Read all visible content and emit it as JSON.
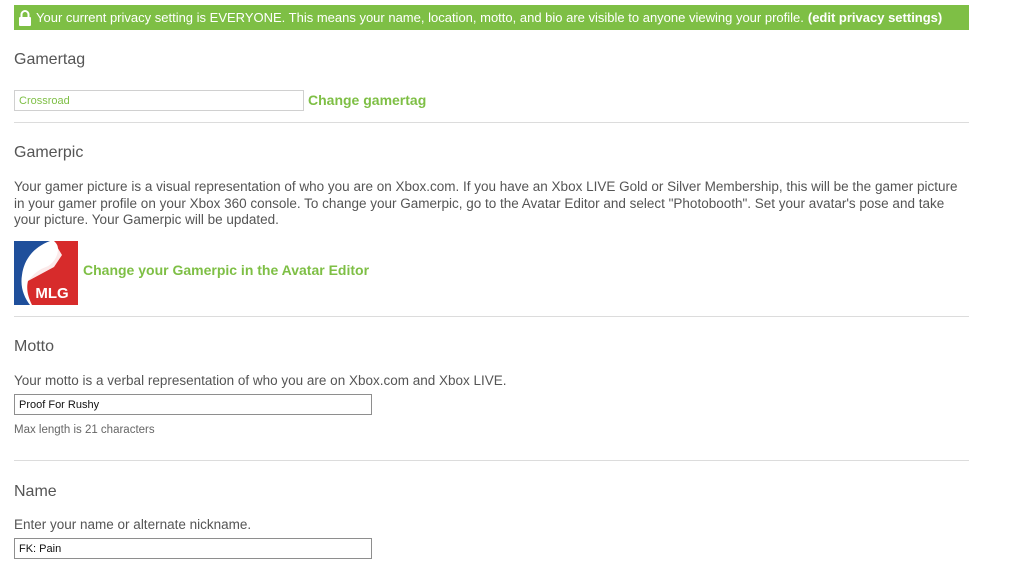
{
  "privacy": {
    "message": "Your current privacy setting is EVERYONE. This means your name, location, motto, and bio are visible to anyone viewing your profile.",
    "link": "(edit privacy settings)",
    "icon": "lock-icon",
    "color": "#7ebf45"
  },
  "gamertag": {
    "title": "Gamertag",
    "value": "Crossroad",
    "change_link": "Change gamertag"
  },
  "gamerpic": {
    "title": "Gamerpic",
    "description": "Your gamer picture is a visual representation of who you are on Xbox.com. If you have an Xbox LIVE Gold or Silver Membership, this will be the gamer picture in your gamer profile on your Xbox 360 console. To change your Gamerpic, go to the Avatar Editor and select \"Photobooth\". Set your avatar's pose and take your picture. Your Gamerpic will be updated.",
    "image_text": "MLG",
    "change_link": "Change your Gamerpic in the Avatar Editor"
  },
  "motto": {
    "title": "Motto",
    "description": "Your motto is a verbal representation of who you are on Xbox.com and Xbox LIVE.",
    "value": "Proof For Rushy",
    "hint": "Max length is 21 characters"
  },
  "name": {
    "title": "Name",
    "description": "Enter your name or alternate nickname.",
    "value": "FK: Pain"
  }
}
